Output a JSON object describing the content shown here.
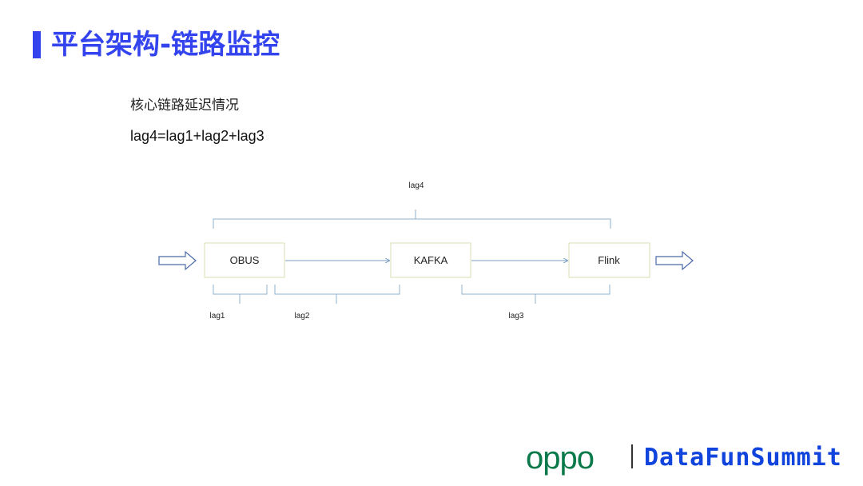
{
  "slide": {
    "title": "平台架构-链路监控",
    "subtitle": "核心链路延迟情况",
    "formula": "lag4=lag1+lag2+lag3"
  },
  "diagram": {
    "nodes": [
      {
        "id": "obus",
        "label": "OBUS"
      },
      {
        "id": "kafka",
        "label": "KAFKA"
      },
      {
        "id": "flink",
        "label": "Flink"
      }
    ],
    "lags": [
      {
        "id": "lag1",
        "label": "lag1"
      },
      {
        "id": "lag2",
        "label": "lag2"
      },
      {
        "id": "lag3",
        "label": "lag3"
      },
      {
        "id": "lag4",
        "label": "lag4"
      }
    ],
    "colors": {
      "node_border": "#d8dcb4",
      "bracket": "#8fb0cc",
      "flow_arrow": "#4a6aa8",
      "connector": "#7a9ec2"
    }
  },
  "footer": {
    "brand": "oppo",
    "event": "DataFunSummit",
    "brand_color": "#0b7a4b",
    "event_color": "#1144dd"
  }
}
